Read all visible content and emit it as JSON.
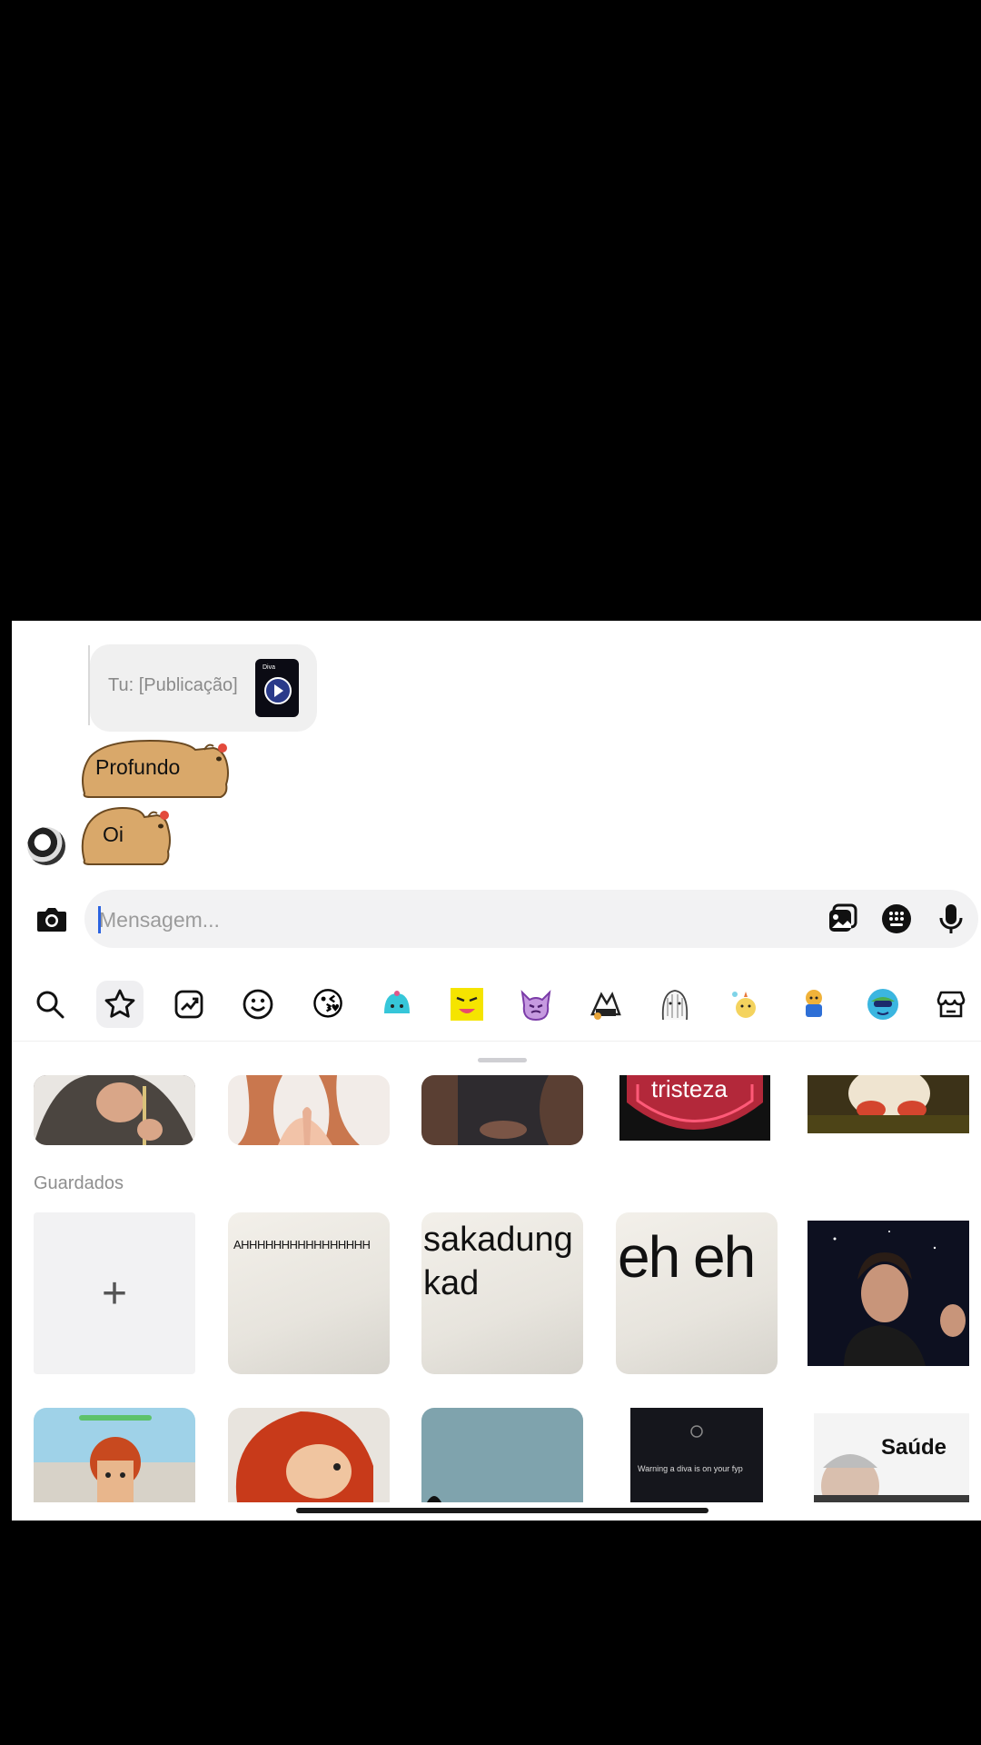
{
  "conversation": {
    "reply_preview": "Tu: [Publicação]",
    "reply_thumb_tag": "Diva",
    "messages": [
      {
        "text": "Profundo",
        "style": "capybara-bubble"
      },
      {
        "text": "Oi",
        "style": "capybara-bubble"
      }
    ]
  },
  "composer": {
    "placeholder": "Mensagem...",
    "icons": [
      "camera-icon",
      "gallery-icon",
      "sticker-grid-icon",
      "microphone-icon"
    ]
  },
  "sticker_toolbar": {
    "icons": [
      "search-icon",
      "favorites-star-icon",
      "trending-icon",
      "emoji-smile-icon",
      "sticker-pack-1",
      "sticker-pack-2",
      "sticker-pack-3",
      "sticker-pack-4",
      "sticker-pack-5",
      "sticker-pack-6",
      "sticker-pack-7",
      "sticker-pack-8",
      "sticker-pack-9",
      "store-icon"
    ],
    "active": "favorites-star-icon"
  },
  "top_row_labels": {
    "tristeza": "tristeza"
  },
  "saved": {
    "title": "Guardados",
    "add_label": "+",
    "items": [
      {
        "text": "AHHHHHHHHHHHHHHHH"
      },
      {
        "text": "sakadung kad"
      },
      {
        "text": "eh eh"
      }
    ]
  },
  "bottom_row_labels": {
    "warning": "Warning a diva is on your fyp",
    "saude": "Saúde"
  },
  "colors": {
    "accent": "#2b63e0",
    "capybara": "#d9a86a",
    "panel": "#ffffff"
  }
}
